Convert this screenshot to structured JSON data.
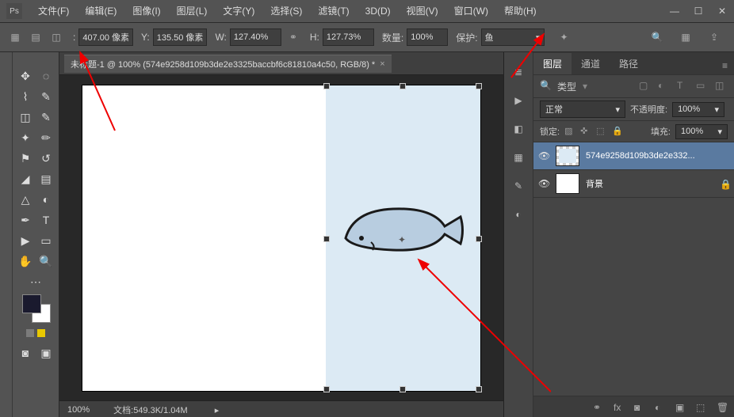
{
  "menu": {
    "items": [
      "文件(F)",
      "编辑(E)",
      "图像(I)",
      "图层(L)",
      "文字(Y)",
      "选择(S)",
      "滤镜(T)",
      "3D(D)",
      "视图(V)",
      "窗口(W)",
      "帮助(H)"
    ]
  },
  "options": {
    "x_label": ":",
    "x": "407.00 像素",
    "y_label": "Y:",
    "y": "135.50 像素",
    "w_label": "W:",
    "w": "127.40%",
    "h_label": "H:",
    "h": "127.73%",
    "qty_label": "数量:",
    "qty": "100%",
    "protect_label": "保护:",
    "protect": "鱼"
  },
  "tab": {
    "title": "未标题-1 @ 100% (574e9258d109b3de2e3325baccbf6c81810a4c50, RGB/8) *"
  },
  "status": {
    "zoom": "100%",
    "doc": "文档:549.3K/1.04M"
  },
  "layerpanel": {
    "tabs": [
      "图层",
      "通道",
      "路径"
    ],
    "filter_label": "类型",
    "blend": "正常",
    "opacity_label": "不透明度:",
    "opacity": "100%",
    "lock_label": "锁定:",
    "fill_label": "填充:",
    "fill": "100%",
    "layers": [
      {
        "name": "574e9258d109b3de2e332...",
        "locked": false
      },
      {
        "name": "背景",
        "locked": true
      }
    ]
  }
}
